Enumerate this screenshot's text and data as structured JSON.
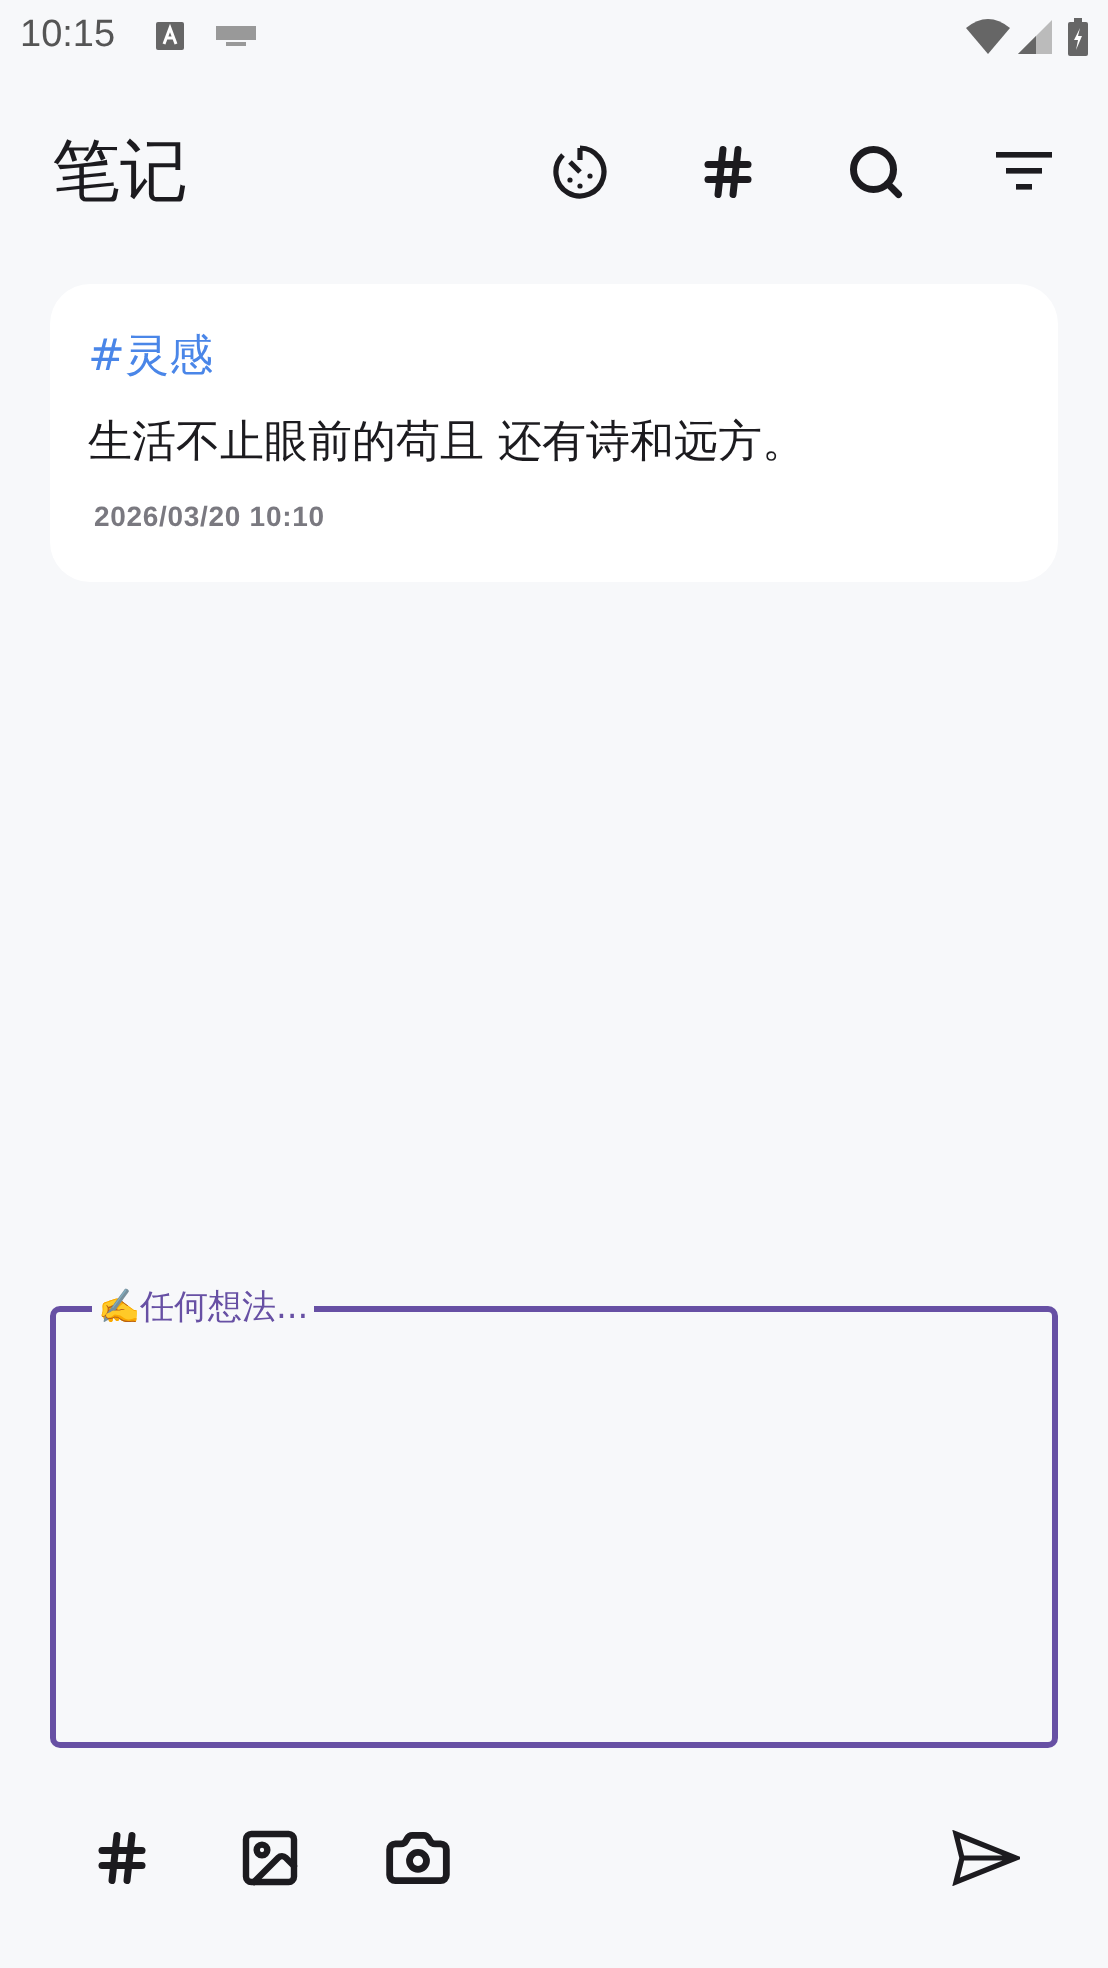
{
  "status_bar": {
    "time": "10:15"
  },
  "header": {
    "title": "笔记"
  },
  "notes": [
    {
      "tag": "#灵感",
      "text": "生活不止眼前的苟且 还有诗和远方。",
      "date": "2026/03/20 10:10"
    }
  ],
  "composer": {
    "label": "✍️任何想法..."
  }
}
